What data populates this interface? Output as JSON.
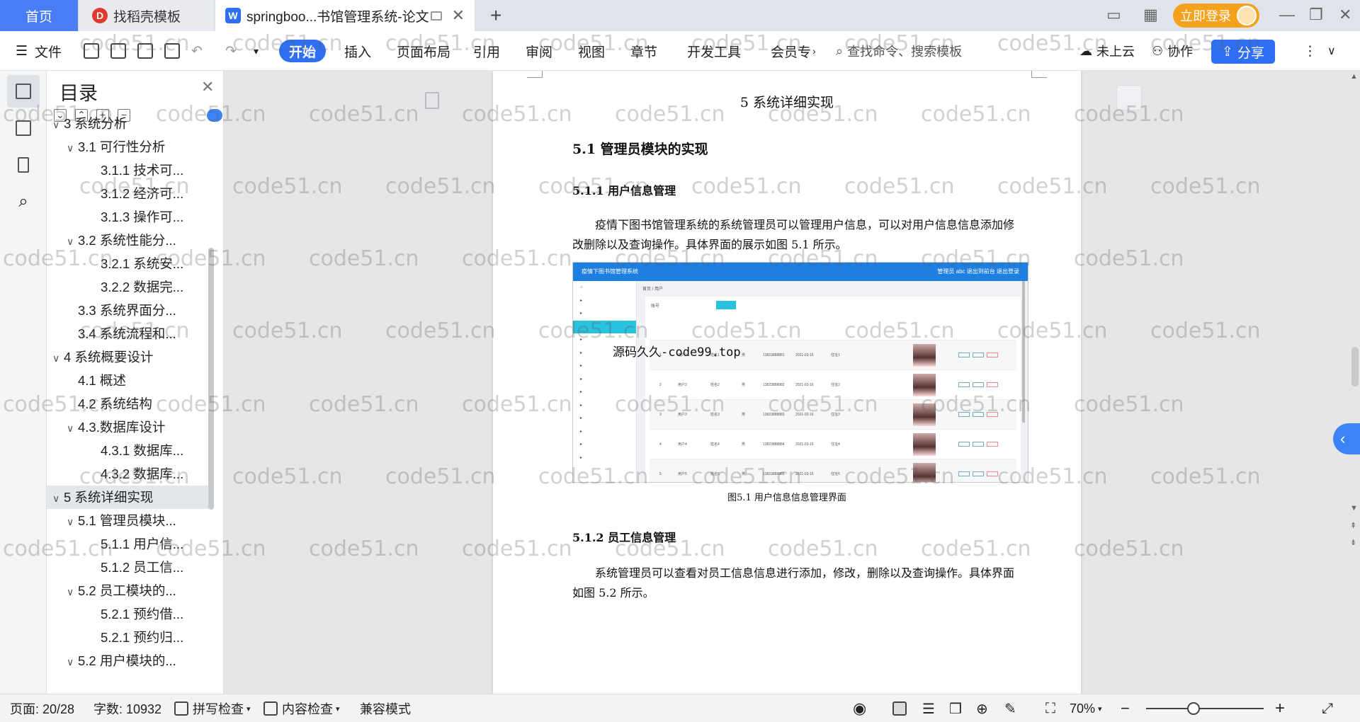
{
  "tabs": [
    {
      "label": "首页"
    },
    {
      "label": "找稻壳模板"
    },
    {
      "label": "springboo...书馆管理系统-论文"
    }
  ],
  "titlebar": {
    "login_label": "立即登录"
  },
  "ribbon": {
    "file_label": "文件",
    "tabs": [
      "开始",
      "插入",
      "页面布局",
      "引用",
      "审阅",
      "视图",
      "章节",
      "开发工具",
      "会员专"
    ],
    "search_placeholder": "查找命令、搜索模板",
    "cloud_label": "未上云",
    "collab_label": "协作",
    "share_label": "分享"
  },
  "toc": {
    "title": "目录",
    "items": [
      {
        "label": "3 系统分析",
        "level": 1,
        "caret": "∨"
      },
      {
        "label": "3.1 可行性分析",
        "level": 2,
        "caret": "∨"
      },
      {
        "label": "3.1.1 技术可...",
        "level": 3,
        "caret": ""
      },
      {
        "label": "3.1.2 经济可...",
        "level": 3,
        "caret": ""
      },
      {
        "label": "3.1.3 操作可...",
        "level": 3,
        "caret": ""
      },
      {
        "label": "3.2 系统性能分...",
        "level": 2,
        "caret": "∨"
      },
      {
        "label": "3.2.1  系统安...",
        "level": 3,
        "caret": ""
      },
      {
        "label": "3.2.2  数据完...",
        "level": 3,
        "caret": ""
      },
      {
        "label": "3.3 系统界面分...",
        "level": 2,
        "caret": ""
      },
      {
        "label": "3.4 系统流程和...",
        "level": 2,
        "caret": ""
      },
      {
        "label": "4 系统概要设计",
        "level": 1,
        "caret": "∨"
      },
      {
        "label": "4.1 概述",
        "level": 2,
        "caret": ""
      },
      {
        "label": "4.2 系统结构",
        "level": 2,
        "caret": ""
      },
      {
        "label": "4.3.数据库设计",
        "level": 2,
        "caret": "∨"
      },
      {
        "label": "4.3.1 数据库...",
        "level": 3,
        "caret": ""
      },
      {
        "label": "4.3.2 数据库...",
        "level": 3,
        "caret": ""
      },
      {
        "label": "5 系统详细实现",
        "level": 1,
        "caret": "∨",
        "selected": true
      },
      {
        "label": "5.1  管理员模块...",
        "level": 2,
        "caret": "∨"
      },
      {
        "label": "5.1.1  用户信...",
        "level": 3,
        "caret": ""
      },
      {
        "label": "5.1.2  员工信...",
        "level": 3,
        "caret": ""
      },
      {
        "label": "5.2  员工模块的...",
        "level": 2,
        "caret": "∨"
      },
      {
        "label": "5.2.1  预约借...",
        "level": 3,
        "caret": ""
      },
      {
        "label": "5.2.1  预约归...",
        "level": 3,
        "caret": ""
      },
      {
        "label": "5.2  用户模块的...",
        "level": 2,
        "caret": "∨"
      }
    ]
  },
  "document": {
    "chapter_title": "5 系统详细实现",
    "section_title": "5.1  管理员模块的实现",
    "sub1_title": "5.1.1  用户信息管理",
    "para1": "疫情下图书馆管理系统的系统管理员可以管理用户信息，可以对用户信息信息添加修改删除以及查询操作。具体界面的展示如图 5.1 所示。",
    "fig_caption": "图5.1  用户信息信息管理界面",
    "sub2_title": "5.1.2  员工信息管理",
    "para2": "系统管理员可以查看对员工信息信息进行添加，修改，删除以及查询操作。具体界面如图 5.2 所示。",
    "figure_watermark": "源码久久-code99.top",
    "figure": {
      "app_title": "疫情下图书馆管理系统",
      "header_right": "管理员 abc    退出到前台    退出登录",
      "crumb": "首页 / 用户",
      "search_label": "账号",
      "rows": [
        {
          "no": "1",
          "acct": "用户1",
          "name": "姓名1",
          "sex": "男",
          "phone": "13823888881",
          "date": "2021-03-16",
          "addr": "住址1"
        },
        {
          "no": "2",
          "acct": "用户2",
          "name": "姓名2",
          "sex": "男",
          "phone": "13823888882",
          "date": "2021-03-16",
          "addr": "住址2"
        },
        {
          "no": "3",
          "acct": "用户3",
          "name": "姓名3",
          "sex": "男",
          "phone": "13823888883",
          "date": "2021-03-16",
          "addr": "住址3"
        },
        {
          "no": "4",
          "acct": "用户4",
          "name": "姓名4",
          "sex": "男",
          "phone": "13823888884",
          "date": "2021-03-16",
          "addr": "住址4"
        },
        {
          "no": "5",
          "acct": "用户5",
          "name": "姓名5",
          "sex": "男",
          "phone": "13823888885",
          "date": "2021-03-16",
          "addr": "住址5"
        }
      ]
    }
  },
  "watermark_text": "code51.cn",
  "status": {
    "page": "页面: 20/28",
    "words": "字数: 10932",
    "spell": "拼写检查",
    "content": "内容检查",
    "compat": "兼容模式",
    "zoom": "70%"
  },
  "colors": {
    "accent": "#2f6ff2",
    "login": "#f4a21d",
    "home_tab": "#4a7cf6"
  }
}
